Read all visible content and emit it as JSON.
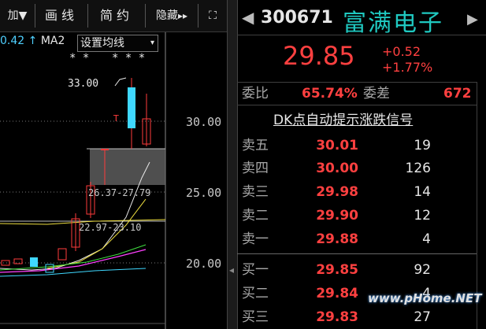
{
  "toolbar": {
    "add_label": "加",
    "dropdown_arrow": "▼",
    "draw_line_label": "画线",
    "simple_label": "简约",
    "hide_label": "隐藏",
    "hide_arrows": "▸▸",
    "fullscreen_label": "⛶"
  },
  "chart": {
    "ma_value": "0.42",
    "ma_arrow": "↑",
    "ma_label": "MA2",
    "ma_select": "设置均线",
    "stars_left": "* *",
    "stars_right": "* * *",
    "high_label": "33.00",
    "axis_labels": [
      "30.00",
      "25.00",
      "20.00"
    ],
    "zone_upper": "26.37-27.79",
    "zone_lower": "22.97-23.10",
    "colors": {
      "up": "#ff3b3b",
      "down": "#3fd8ff",
      "ma_white": "#e8e8e8",
      "ma_yellow": "#f0e040",
      "ma_green": "#40e040",
      "ma_magenta": "#ff40ff"
    }
  },
  "stock": {
    "code": "300671",
    "name": "富满电子",
    "price": "29.85",
    "change": "+0.52",
    "change_pct": "+1.77%",
    "weibi_label": "委比",
    "weibi_value": "65.74%",
    "weicha_label": "委差",
    "weicha_value": "672",
    "signal_link": "DK点自动提示涨跌信号"
  },
  "order_book": {
    "asks": [
      {
        "label": "卖五",
        "price": "30.01",
        "vol": "19"
      },
      {
        "label": "卖四",
        "price": "30.00",
        "vol": "126"
      },
      {
        "label": "卖三",
        "price": "29.98",
        "vol": "14"
      },
      {
        "label": "卖二",
        "price": "29.90",
        "vol": "12"
      },
      {
        "label": "卖一",
        "price": "29.88",
        "vol": "4"
      }
    ],
    "bids": [
      {
        "label": "买一",
        "price": "29.85",
        "vol": "92"
      },
      {
        "label": "买二",
        "price": "29.84",
        "vol": "4"
      },
      {
        "label": "买三",
        "price": "29.83",
        "vol": "27"
      }
    ]
  },
  "watermark": "www.pHome.NET"
}
